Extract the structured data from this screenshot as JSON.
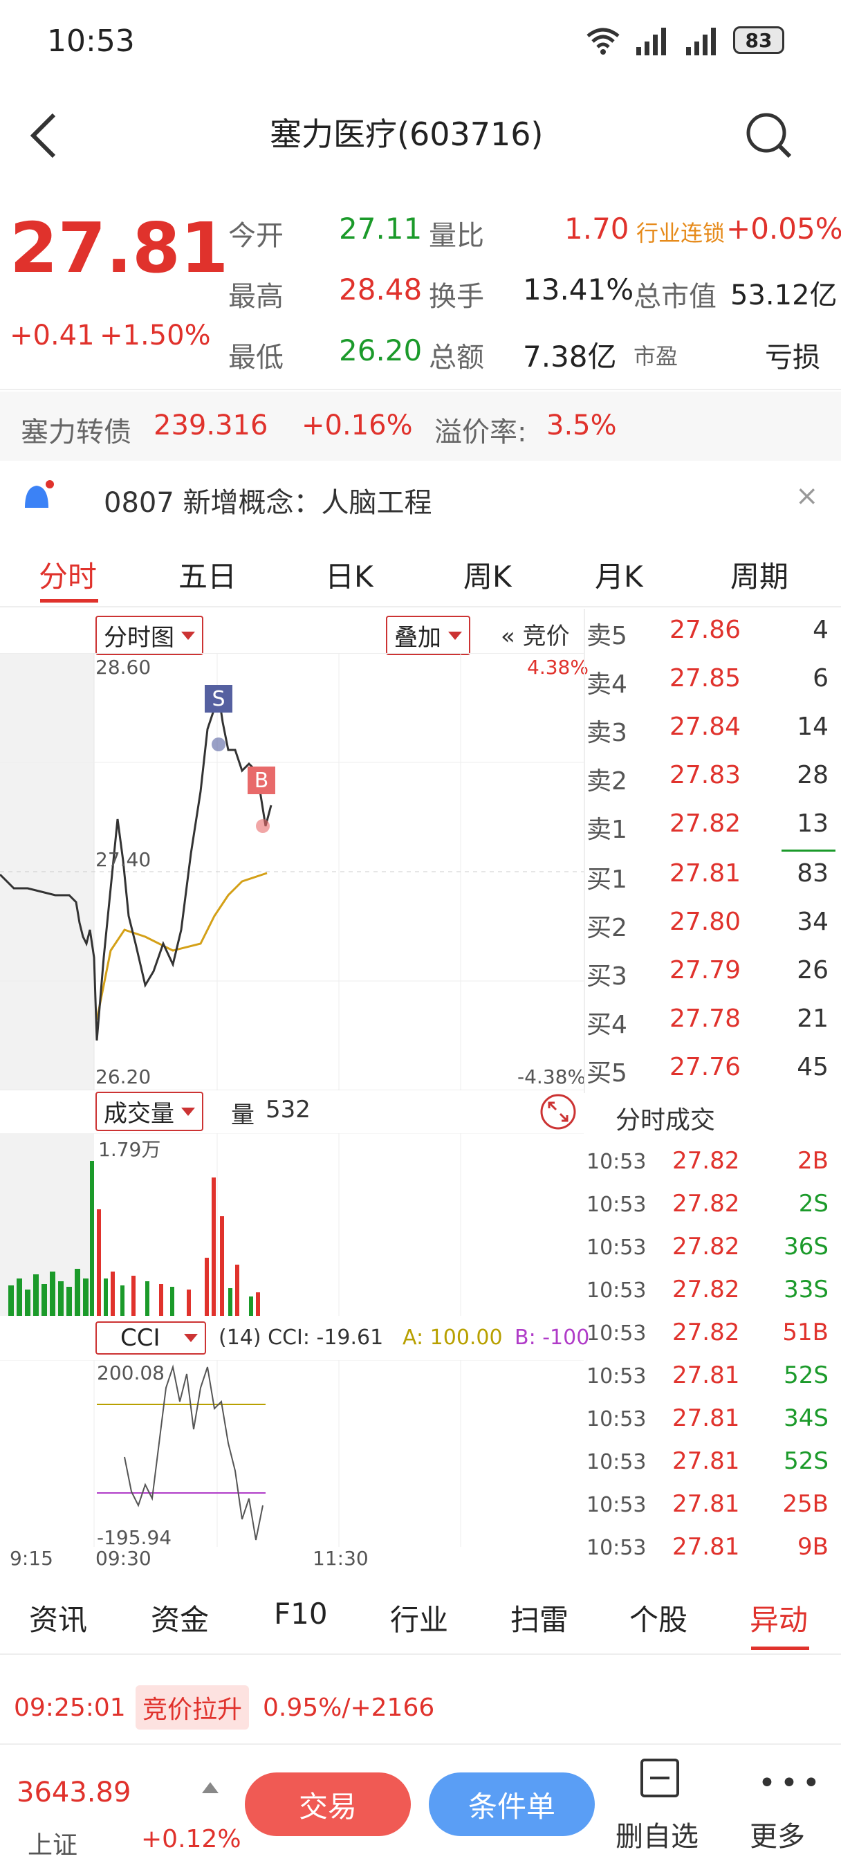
{
  "status_bar": {
    "time": "10:53",
    "battery": "83"
  },
  "header": {
    "title": "塞力医疗(603716)"
  },
  "quote": {
    "price": "27.81",
    "change": "+0.41",
    "change_pct": "+1.50%",
    "stats": [
      {
        "label": "今开",
        "value": "27.11",
        "color": "green"
      },
      {
        "label": "量比",
        "value": "1.70",
        "color": "red"
      },
      {
        "label": "最高",
        "value": "28.48",
        "color": "red"
      },
      {
        "label": "换手",
        "value": "13.41%",
        "color": "dark"
      },
      {
        "label": "最低",
        "value": "26.20",
        "color": "green"
      },
      {
        "label": "总额",
        "value": "7.38亿",
        "color": "dark"
      }
    ],
    "concept": {
      "label": "行业连锁",
      "value": "+0.05%"
    },
    "market_cap": {
      "label": "总市值",
      "value": "53.12亿"
    },
    "pe": {
      "label": "市盈",
      "value": "亏损"
    }
  },
  "bond_bar": {
    "name": "塞力转债",
    "price": "239.316",
    "change": "+0.16%",
    "premium_label": "溢价率:",
    "premium": "3.5%"
  },
  "news_bar": {
    "text": "0807 新增概念：人脑工程"
  },
  "chart_tabs": [
    "分时",
    "五日",
    "日K",
    "周K",
    "月K",
    "周期"
  ],
  "chart_toolbar": {
    "mode": "分时图",
    "overlay": "叠加",
    "bid_label": "竞价"
  },
  "chart": {
    "price_high": "28.60",
    "price_mid": "27.40",
    "price_low": "26.20",
    "pct_high": "4.38%",
    "pct_low": "-4.38%",
    "marker_s": "S",
    "marker_b": "B"
  },
  "volume": {
    "selector": "成交量",
    "label": "量",
    "value": "532",
    "max": "1.79万"
  },
  "indicator": {
    "selector": "CCI",
    "params": "(14) CCI: -19.61",
    "a": "A: 100.00",
    "b": "B: -100",
    "max": "200.08",
    "min": "-195.94"
  },
  "time_axis": [
    "9:15",
    "09:30",
    "11:30"
  ],
  "order_book": [
    {
      "label": "卖5",
      "price": "27.86",
      "vol": "4"
    },
    {
      "label": "卖4",
      "price": "27.85",
      "vol": "6"
    },
    {
      "label": "卖3",
      "price": "27.84",
      "vol": "14"
    },
    {
      "label": "卖2",
      "price": "27.83",
      "vol": "28"
    },
    {
      "label": "卖1",
      "price": "27.82",
      "vol": "13"
    },
    {
      "label": "买1",
      "price": "27.81",
      "vol": "83"
    },
    {
      "label": "买2",
      "price": "27.80",
      "vol": "34"
    },
    {
      "label": "买3",
      "price": "27.79",
      "vol": "26"
    },
    {
      "label": "买4",
      "price": "27.78",
      "vol": "21"
    },
    {
      "label": "买5",
      "price": "27.76",
      "vol": "45"
    }
  ],
  "trades_header": "分时成交",
  "trades": [
    {
      "time": "10:53",
      "price": "27.82",
      "vol": "2B"
    },
    {
      "time": "10:53",
      "price": "27.82",
      "vol": "2S"
    },
    {
      "time": "10:53",
      "price": "27.82",
      "vol": "36S"
    },
    {
      "time": "10:53",
      "price": "27.82",
      "vol": "33S"
    },
    {
      "time": "10:53",
      "price": "27.82",
      "vol": "51B"
    },
    {
      "time": "10:53",
      "price": "27.81",
      "vol": "52S"
    },
    {
      "time": "10:53",
      "price": "27.81",
      "vol": "34S"
    },
    {
      "time": "10:53",
      "price": "27.81",
      "vol": "52S"
    },
    {
      "time": "10:53",
      "price": "27.81",
      "vol": "25B"
    },
    {
      "time": "10:53",
      "price": "27.81",
      "vol": "9B"
    }
  ],
  "info_tabs": [
    "资讯",
    "资金",
    "F10",
    "行业",
    "扫雷",
    "个股",
    "异动"
  ],
  "anomaly": {
    "time": "09:25:01",
    "tag": "竞价拉升",
    "value": "0.95%/+2166"
  },
  "bottom_bar": {
    "index_value": "3643.89",
    "index_name": "上证",
    "index_change": "+0.12%",
    "trade": "交易",
    "condition": "条件单",
    "remove": "删自选",
    "more": "更多"
  }
}
